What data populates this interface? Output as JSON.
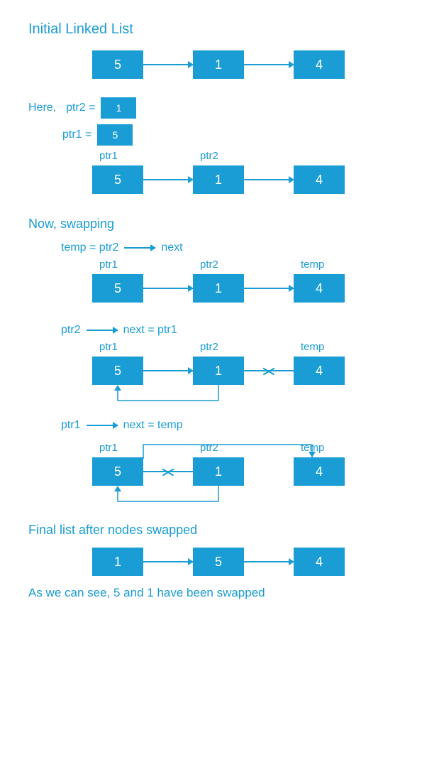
{
  "accent": "#1a9cd4",
  "titles": {
    "initial": "Initial Linked List",
    "swapping": "Now,   swapping",
    "final": "Final list after nodes swapped",
    "conclusion": "As we can see,  5 and 1 have been swapped"
  },
  "here_label": "Here,",
  "ptr2_eq": "ptr2  =",
  "ptr1_eq": "ptr1  =",
  "labels": {
    "ptr1": "ptr1",
    "ptr2": "ptr2",
    "temp": "temp",
    "next": "next"
  },
  "step1_expr": {
    "lhs": "temp  =  ptr2",
    "rhs": "next"
  },
  "step2_expr": {
    "lhs": "ptr2",
    "rhs": "next  =  ptr1"
  },
  "step3_expr": {
    "lhs": "ptr1",
    "rhs": "next  =  temp"
  },
  "initial_list": [
    "5",
    "1",
    "4"
  ],
  "ptr2_value": "1",
  "ptr1_value": "5",
  "final_list": [
    "1",
    "5",
    "4"
  ]
}
